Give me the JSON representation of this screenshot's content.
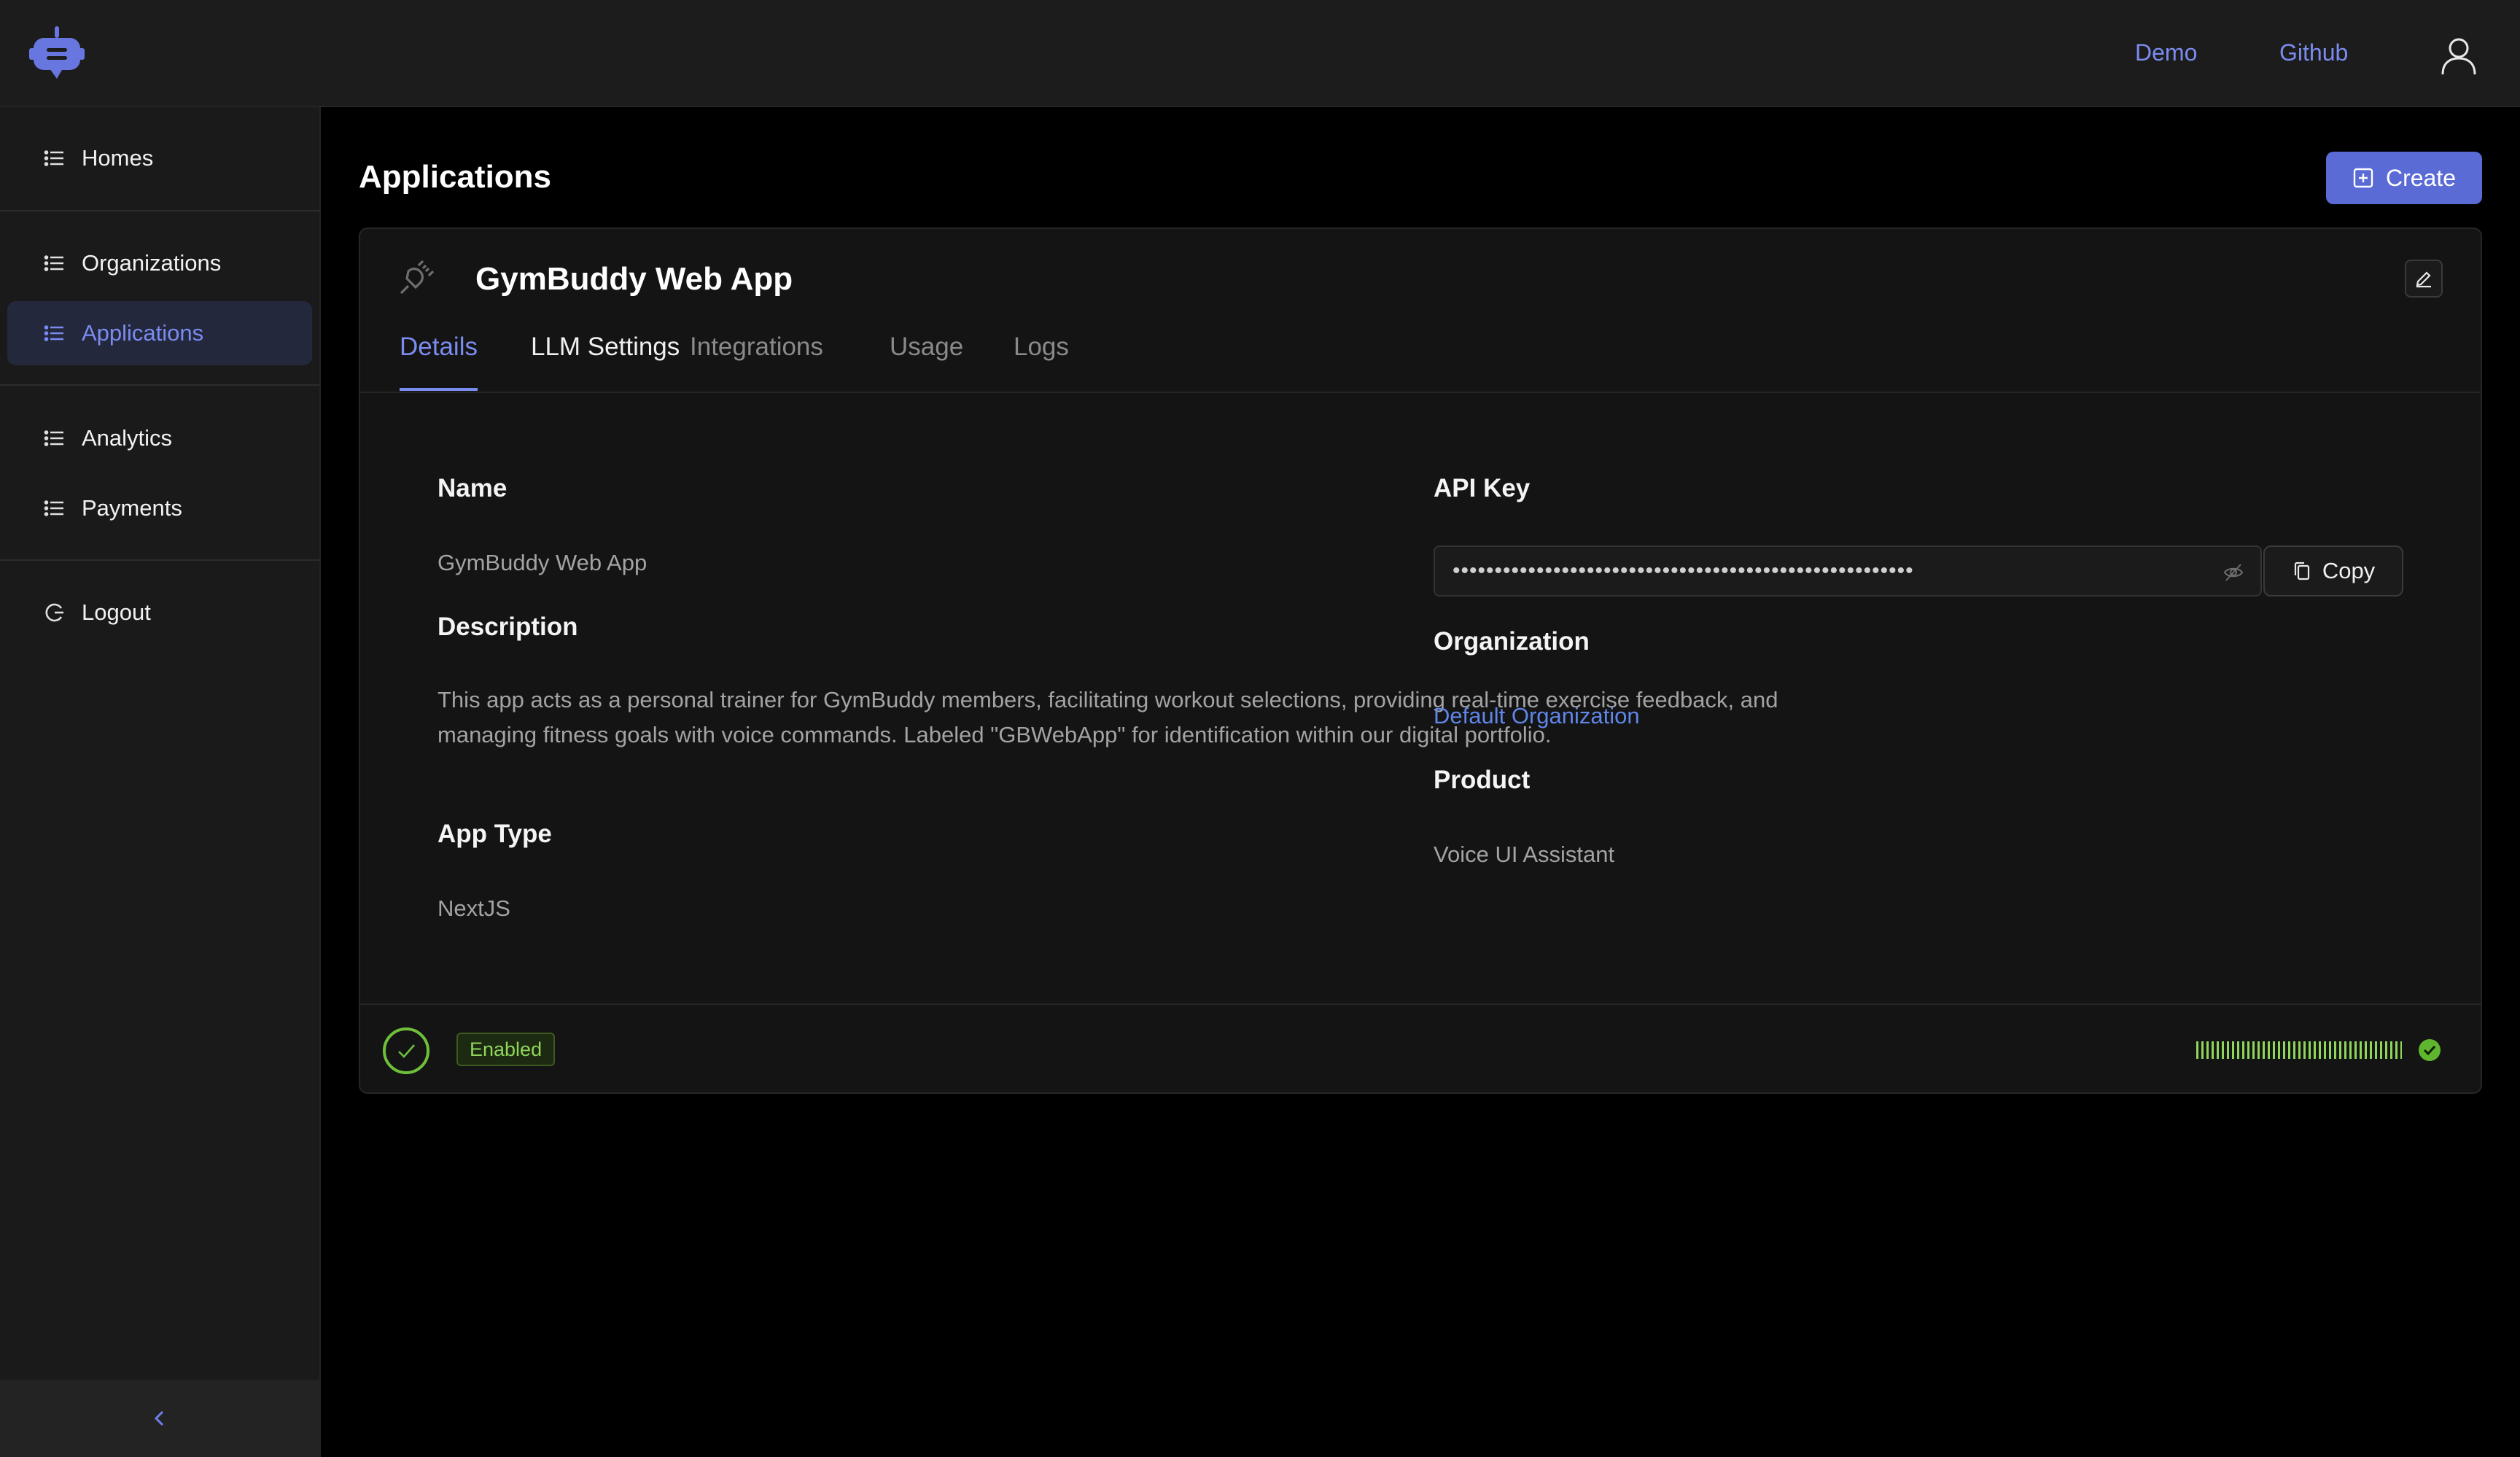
{
  "header": {
    "links": [
      "Demo",
      "Github"
    ]
  },
  "sidebar": {
    "items": [
      {
        "label": "Homes"
      },
      {
        "label": "Organizations"
      },
      {
        "label": "Applications"
      },
      {
        "label": "Analytics"
      },
      {
        "label": "Payments"
      },
      {
        "label": "Logout"
      }
    ],
    "active": "Applications"
  },
  "page": {
    "title": "Applications",
    "create_label": "Create"
  },
  "app": {
    "name": "GymBuddy Web App",
    "tabs": [
      "Details",
      "LLM Settings",
      "Integrations",
      "Usage",
      "Logs"
    ],
    "active_tab": "Details",
    "fields": {
      "name_label": "Name",
      "name_value": "GymBuddy Web App",
      "description_label": "Description",
      "description_value": "This app acts as a personal trainer for GymBuddy members, facilitating workout selections, providing real-time exercise feedback, and managing fitness goals with voice commands. Labeled \"GBWebApp\" for identification within our digital portfolio.",
      "app_type_label": "App Type",
      "app_type_value": "NextJS",
      "api_key_label": "API Key",
      "api_key_masked": "•••••••••••••••••••••••••••••••••••••••••••••••••••••••",
      "copy_label": "Copy",
      "organization_label": "Organization",
      "organization_value": "Default Organization",
      "product_label": "Product",
      "product_value": "Voice UI Assistant"
    },
    "status": "Enabled"
  },
  "colors": {
    "accent": "#7b8cf0",
    "primary_button": "#5b6bd6",
    "link": "#5f86e8",
    "success": "#8fd65a"
  }
}
